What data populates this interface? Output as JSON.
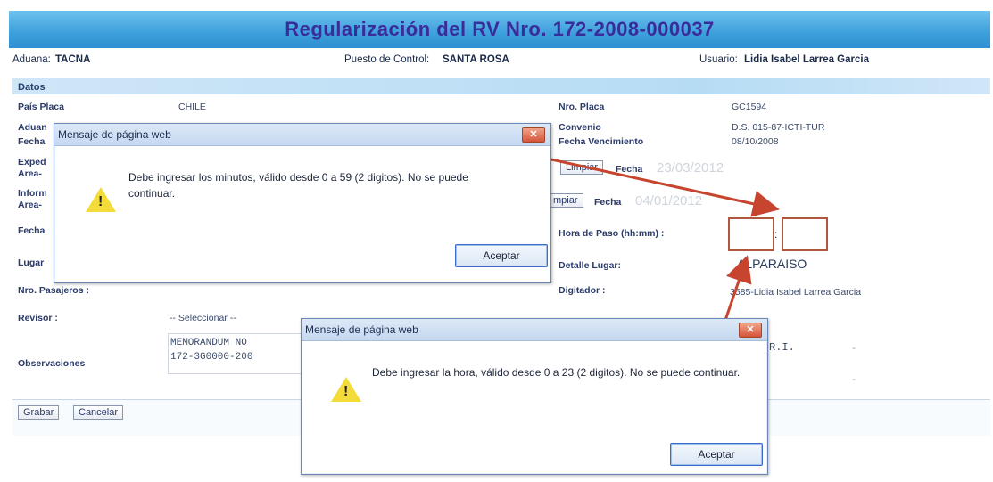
{
  "title": "Regularización del RV Nro. 172-2008-000037",
  "header": {
    "aduana_label": "Aduana:",
    "aduana_value": "TACNA",
    "puesto_label": "Puesto de Control:",
    "puesto_value": "SANTA ROSA",
    "usuario_label": "Usuario:",
    "usuario_value": "Lidia Isabel Larrea Garcia"
  },
  "section_title": "Datos",
  "left_fields": {
    "pais_placa_label": "País Placa",
    "pais_placa_value": "CHILE",
    "aduana_partial": "Aduan",
    "fecha_partial": "Fecha",
    "expediente_partial": "Exped",
    "area_partial_1": "Area-",
    "informe_partial": "Inform",
    "area_partial_2": "Area-",
    "fecha2_partial": "Fecha",
    "lugar_partial": "Lugar",
    "nro_pasajeros_label": "Nro. Pasajeros :",
    "revisor_label": "Revisor :",
    "revisor_select": "-- Seleccionar --",
    "observaciones_label": "Observaciones",
    "observaciones_line1": "MEMORANDUM NO",
    "observaciones_line2": "172-3G0000-200"
  },
  "right_fields": {
    "nro_placa_label": "Nro. Placa",
    "nro_placa_value": "GC1594",
    "convenio_label": "Convenio",
    "convenio_value": "D.S. 015-87-ICTI-TUR",
    "fecha_venc_label": "Fecha Vencimiento",
    "fecha_venc_value": "08/10/2008",
    "limpiar_label_1": "Limpiar",
    "fecha_label_1": "Fecha",
    "fecha_value_1": "23/03/2012",
    "limpiar_label_2": "mpiar",
    "fecha_label_2": "Fecha",
    "fecha_value_2": "04/01/2012",
    "hora_paso_label": "Hora de Paso (hh:mm) :",
    "hora_sep": ":",
    "detalle_lugar_label": "Detalle Lugar:",
    "detalle_lugar_value": "ALPARAISO",
    "digitador_label": "Digitador :",
    "digitador_value": "3585-Lidia Isabel Larrea Garcia",
    "right_text_1": "R.I.",
    "dash_1": "-",
    "dash_2": "-"
  },
  "footer": {
    "grabar": "Grabar",
    "cancelar": "Cancelar"
  },
  "dialog1": {
    "title": "Mensaje de página web",
    "message": "Debe ingresar los minutos, válido desde 0 a 59 (2 digitos). No se puede continuar.",
    "ok": "Aceptar",
    "close": "✕"
  },
  "dialog2": {
    "title": "Mensaje de página web",
    "message": "Debe ingresar la hora, válido desde 0 a 23 (2 digitos). No se puede continuar.",
    "ok": "Aceptar",
    "close": "✕"
  },
  "colors": {
    "accent": "#3d9fdc",
    "title_text": "#3a2c9a",
    "arrow": "#c7452e",
    "warning": "#f3dc3a"
  }
}
